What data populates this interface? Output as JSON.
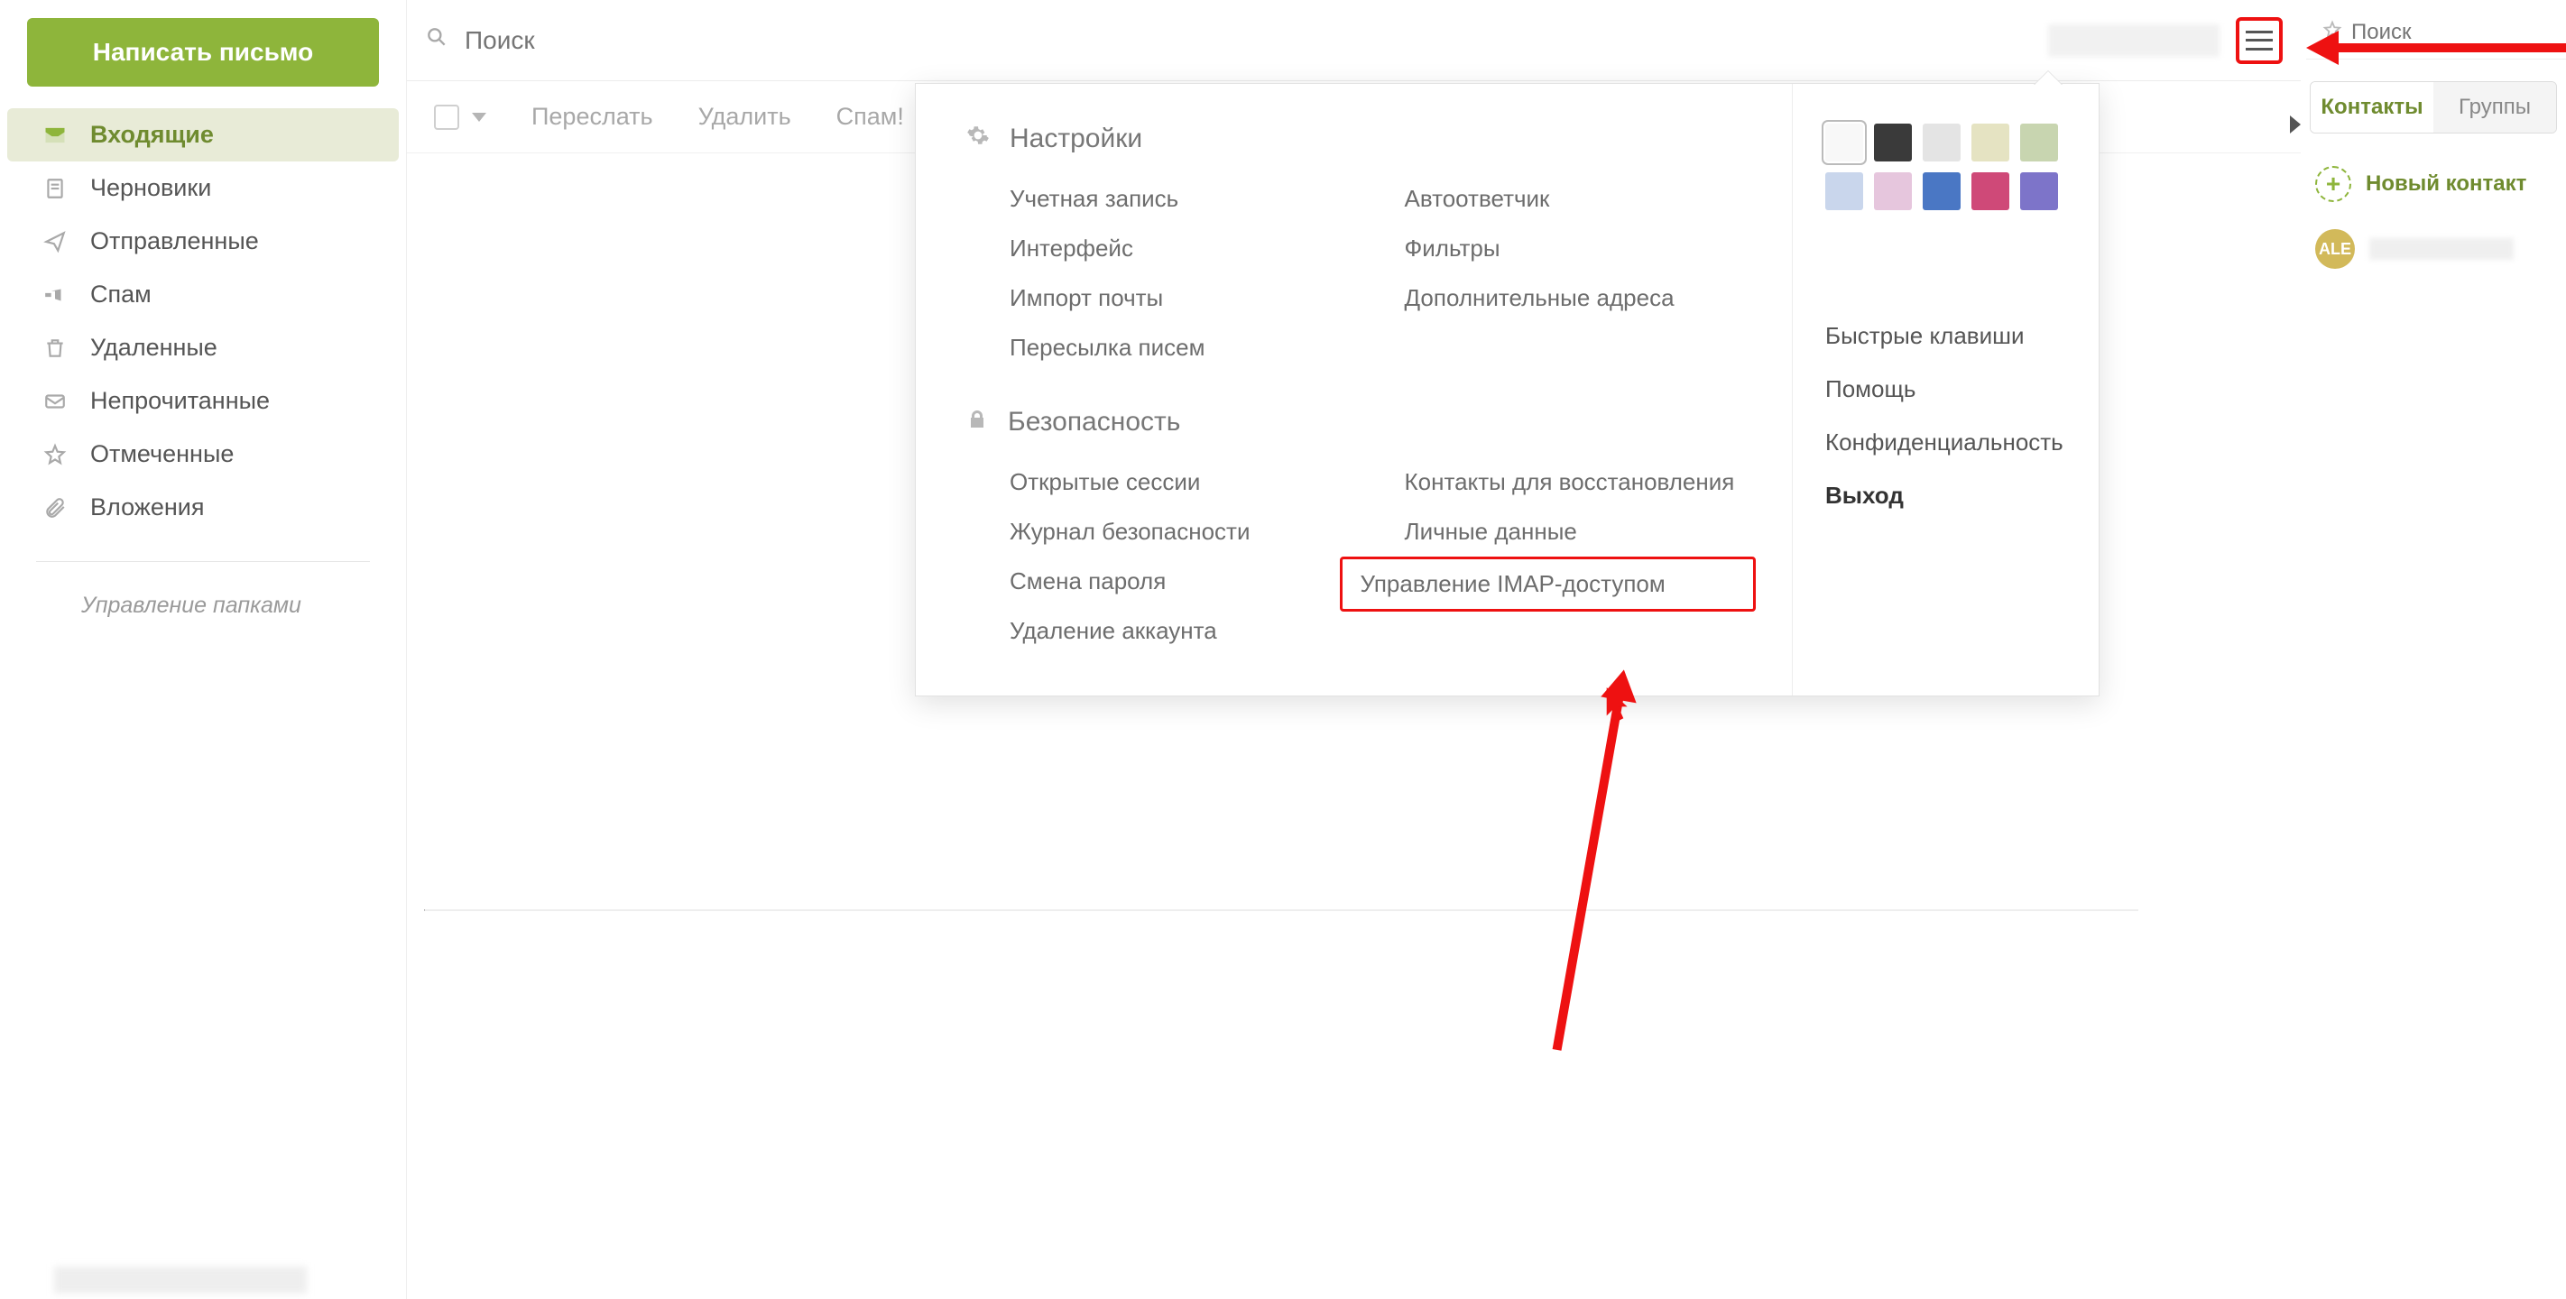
{
  "compose_label": "Написать письмо",
  "folders": [
    {
      "label": "Входящие",
      "icon": "inbox"
    },
    {
      "label": "Черновики",
      "icon": "draft"
    },
    {
      "label": "Отправленные",
      "icon": "sent"
    },
    {
      "label": "Спам",
      "icon": "spam"
    },
    {
      "label": "Удаленные",
      "icon": "trash"
    },
    {
      "label": "Непрочитанные",
      "icon": "unread"
    },
    {
      "label": "Отмеченные",
      "icon": "star"
    },
    {
      "label": "Вложения",
      "icon": "attach"
    }
  ],
  "manage_folders": "Управление папками",
  "search_placeholder": "Поиск",
  "actions": {
    "forward": "Переслать",
    "delete": "Удалить",
    "spam": "Спам!"
  },
  "dropdown": {
    "settings_heading": "Настройки",
    "settings_col1": [
      "Учетная запись",
      "Интерфейс",
      "Импорт почты",
      "Пересылка писем"
    ],
    "settings_col2": [
      "Автоответчик",
      "Фильтры",
      "Дополнительные адреса"
    ],
    "security_heading": "Безопасность",
    "security_col1": [
      "Открытые сессии",
      "Журнал безопасности",
      "Смена пароля",
      "Удаление аккаунта"
    ],
    "security_col2": [
      "Контакты для восстановления",
      "Личные данные",
      "Управление IMAP-доступом"
    ],
    "swatches": [
      "#f8f8f8",
      "#3a3a3a",
      "#e4e4e4",
      "#e5e3c2",
      "#c8d5b0",
      "#c9d6ec",
      "#e6c6dd",
      "#4a77c4",
      "#cf4978",
      "#7d74c9"
    ],
    "right_links": [
      "Быстрые клавиши",
      "Помощь",
      "Конфиденциальность",
      "Выход"
    ]
  },
  "right_panel": {
    "search_placeholder": "Поиск",
    "tab_contacts": "Контакты",
    "tab_groups": "Группы",
    "new_contact": "Новый контакт",
    "avatar_initials": "ALE"
  }
}
